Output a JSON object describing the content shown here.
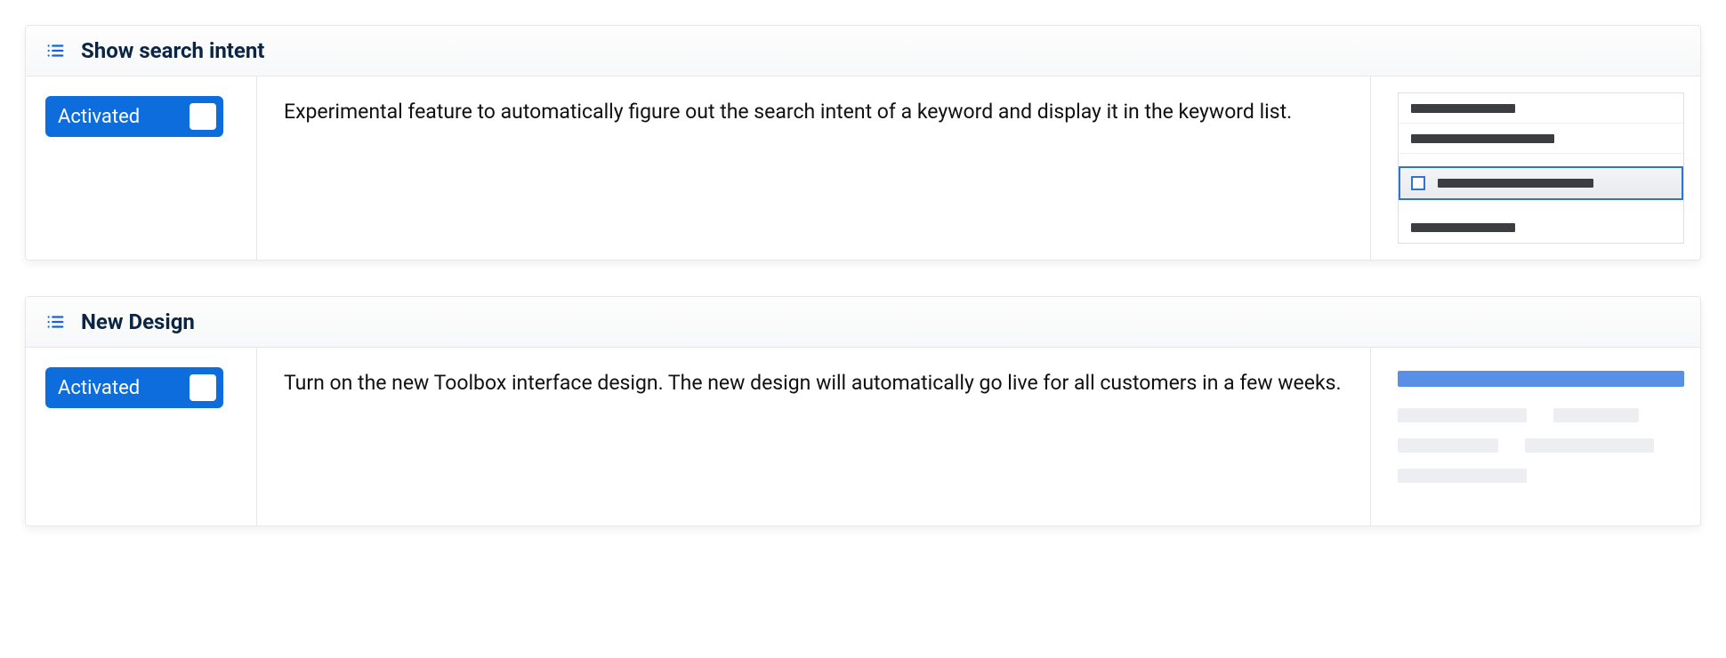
{
  "features": [
    {
      "id": "search-intent",
      "title": "Show search intent",
      "toggle_label": "Activated",
      "description": "Experimental feature to automatically figure out the search intent of a keyword and display it in the keyword list."
    },
    {
      "id": "new-design",
      "title": "New Design",
      "toggle_label": "Activated",
      "description": "Turn on the new Toolbox interface design. The new design will automatically go live for all customers in a few weeks."
    }
  ]
}
